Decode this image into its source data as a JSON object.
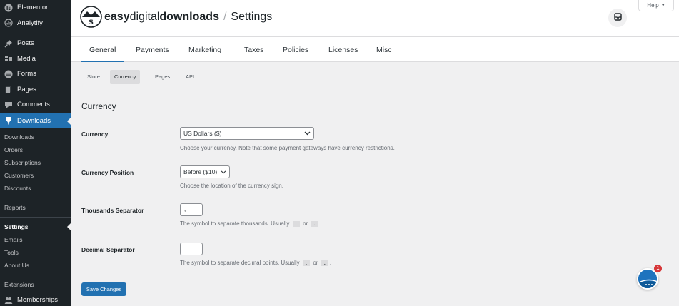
{
  "sidebar": {
    "top_items": [
      {
        "label": "Elementor",
        "icon": "elementor-icon"
      },
      {
        "label": "Analytify",
        "icon": "analytify-icon"
      }
    ],
    "main_items": [
      {
        "label": "Posts",
        "icon": "pin-icon"
      },
      {
        "label": "Media",
        "icon": "media-icon"
      },
      {
        "label": "Forms",
        "icon": "forms-icon"
      },
      {
        "label": "Pages",
        "icon": "pages-icon"
      },
      {
        "label": "Comments",
        "icon": "comment-icon"
      }
    ],
    "downloads": {
      "label": "Downloads",
      "icon": "download-icon"
    },
    "submenu": [
      "Downloads",
      "Orders",
      "Subscriptions",
      "Customers",
      "Discounts"
    ],
    "reports": "Reports",
    "settings_group": [
      "Settings",
      "Emails",
      "Tools",
      "About Us"
    ],
    "extensions": "Extensions",
    "memberships": {
      "label": "Memberships",
      "icon": "memberships-icon"
    }
  },
  "header": {
    "brand_bold1": "easy",
    "brand_light": "digital",
    "brand_bold2": "downloads",
    "separator": "/",
    "page_title": "Settings",
    "help_label": "Help",
    "help_caret": "▼"
  },
  "tabs": [
    "General",
    "Payments",
    "Marketing",
    "Taxes",
    "Policies",
    "Licenses",
    "Misc"
  ],
  "active_tab": "General",
  "subtabs": [
    "Store",
    "Currency",
    "Pages",
    "API"
  ],
  "active_subtab": "Currency",
  "section_title": "Currency",
  "fields": {
    "currency": {
      "label": "Currency",
      "value": "US Dollars ($)",
      "description": "Choose your currency. Note that some payment gateways have currency restrictions."
    },
    "position": {
      "label": "Currency Position",
      "value": "Before ($10)",
      "description": "Choose the location of the currency sign."
    },
    "thousands": {
      "label": "Thousands Separator",
      "value": ",",
      "description_pre": "The symbol to separate thousands. Usually",
      "opt1": ",",
      "or_text": "or",
      "opt2": ".",
      "description_post": "."
    },
    "decimal": {
      "label": "Decimal Separator",
      "value": ".",
      "description_pre": "The symbol to separate decimal points. Usually",
      "opt1": ",",
      "or_text": "or",
      "opt2": ".",
      "description_post": "."
    }
  },
  "save_label": "Save Changes",
  "fab_badge": "1",
  "colors": {
    "accent": "#2271b1",
    "sidebar": "#1d2327",
    "badge": "#d63638"
  }
}
